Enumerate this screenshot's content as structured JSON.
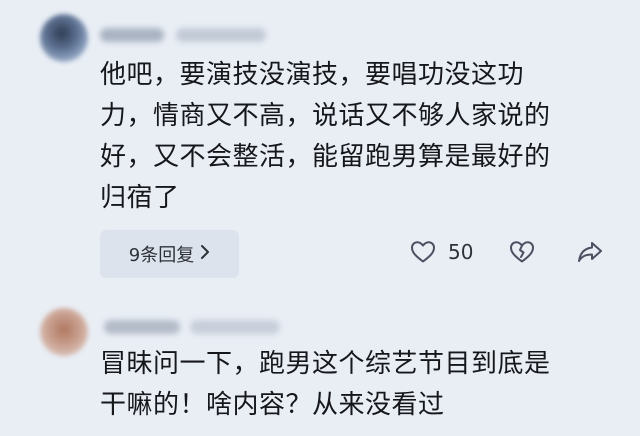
{
  "comments": [
    {
      "lines": [
        "他吧，要演技没演技，要唱功没这功",
        "力，情商又不高，说话又不够人家说的",
        "好，又不会整活，能留跑男算是最好的",
        "归宿了"
      ],
      "replies_label": "9条回复",
      "like_count": "50",
      "icons": [
        "heart-icon",
        "broken-heart-icon",
        "share-arrow-icon",
        "chevron-right-icon"
      ]
    },
    {
      "lines": [
        "冒昧问一下，跑男这个综艺节目到底是",
        "干嘛的！啥内容？从来没看过"
      ]
    }
  ],
  "colors": {
    "background": "#e9eef5",
    "chip": "#dde3ec",
    "text": "#15171b",
    "icon": "#4a5060"
  }
}
